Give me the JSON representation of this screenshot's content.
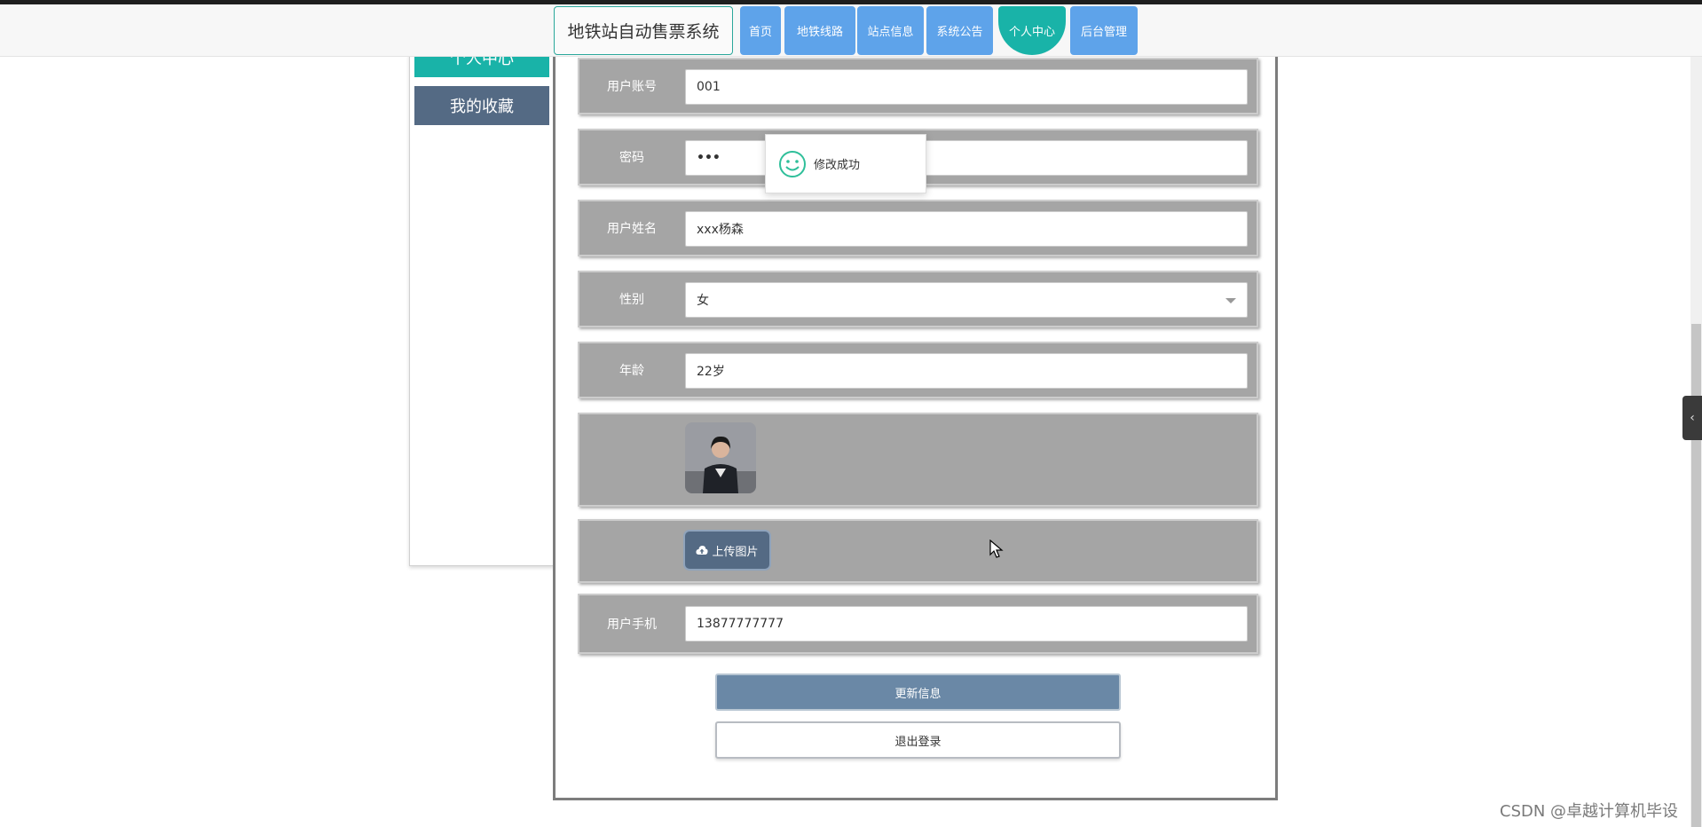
{
  "header": {
    "brand": "地铁站自动售票系统",
    "nav": [
      {
        "label": "首页"
      },
      {
        "label": "地铁线路"
      },
      {
        "label": "站点信息"
      },
      {
        "label": "系统公告"
      },
      {
        "label": "个人中心",
        "active": true
      },
      {
        "label": "后台管理"
      }
    ]
  },
  "sidebar": {
    "items": [
      {
        "label": "个人中心",
        "active": true
      },
      {
        "label": "我的收藏"
      }
    ]
  },
  "form": {
    "account": {
      "label": "用户账号",
      "value": "001"
    },
    "password": {
      "label": "密码",
      "value": "•••"
    },
    "name": {
      "label": "用户姓名",
      "value": "xxx杨森"
    },
    "gender": {
      "label": "性别",
      "value": "女"
    },
    "age": {
      "label": "年龄",
      "value": "22岁"
    },
    "upload_label": "上传图片",
    "phone": {
      "label": "用户手机",
      "value": "13877777777"
    }
  },
  "buttons": {
    "update": "更新信息",
    "logout": "退出登录"
  },
  "toast": {
    "message": "修改成功"
  },
  "watermark": "CSDN @卓越计算机毕设",
  "colors": {
    "accent": "#19b3a8",
    "nav_blue": "#5ea3ea",
    "slate": "#546a84",
    "row_gray": "#a5a5a5"
  }
}
